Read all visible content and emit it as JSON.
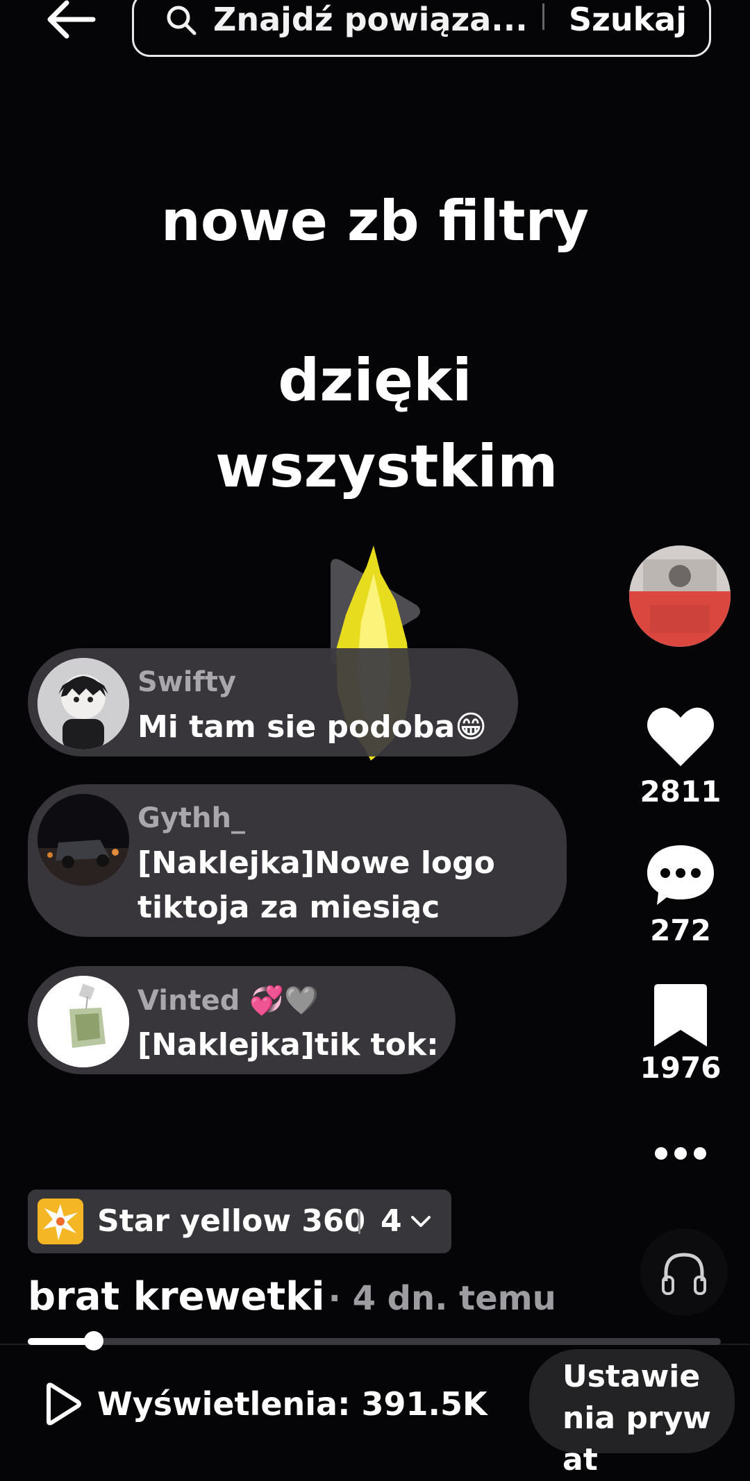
{
  "header": {
    "search_placeholder": "Znajdź powiąza...",
    "search_button": "Szukaj"
  },
  "video": {
    "title": "nowe zb filtry",
    "caption": "dzięki wszystkim"
  },
  "comments": [
    {
      "user": "Swifty",
      "text": "Mi tam sie podoba😁"
    },
    {
      "user": "Gythh_",
      "text": "[Naklejka]Nowe logo tiktoja za miesiąc"
    },
    {
      "user": "Vinted 💞🩶",
      "text": "[Naklejka]tik tok:"
    }
  ],
  "sidebar": {
    "likes": "2811",
    "comments": "272",
    "saves": "1976"
  },
  "effect": {
    "name": "Star yellow 360",
    "count": "4"
  },
  "author": {
    "name": "brat krewetki",
    "time": "· 4 dn. temu"
  },
  "progress": {
    "value": 0.095
  },
  "footer": {
    "views": "Wyświetlenia: 391.5K",
    "privacy": "Ustawienia prywat"
  },
  "colors": {
    "background": "#050406",
    "comment_bubble": "#3c3a40",
    "effect_icon": "#f5b626"
  }
}
